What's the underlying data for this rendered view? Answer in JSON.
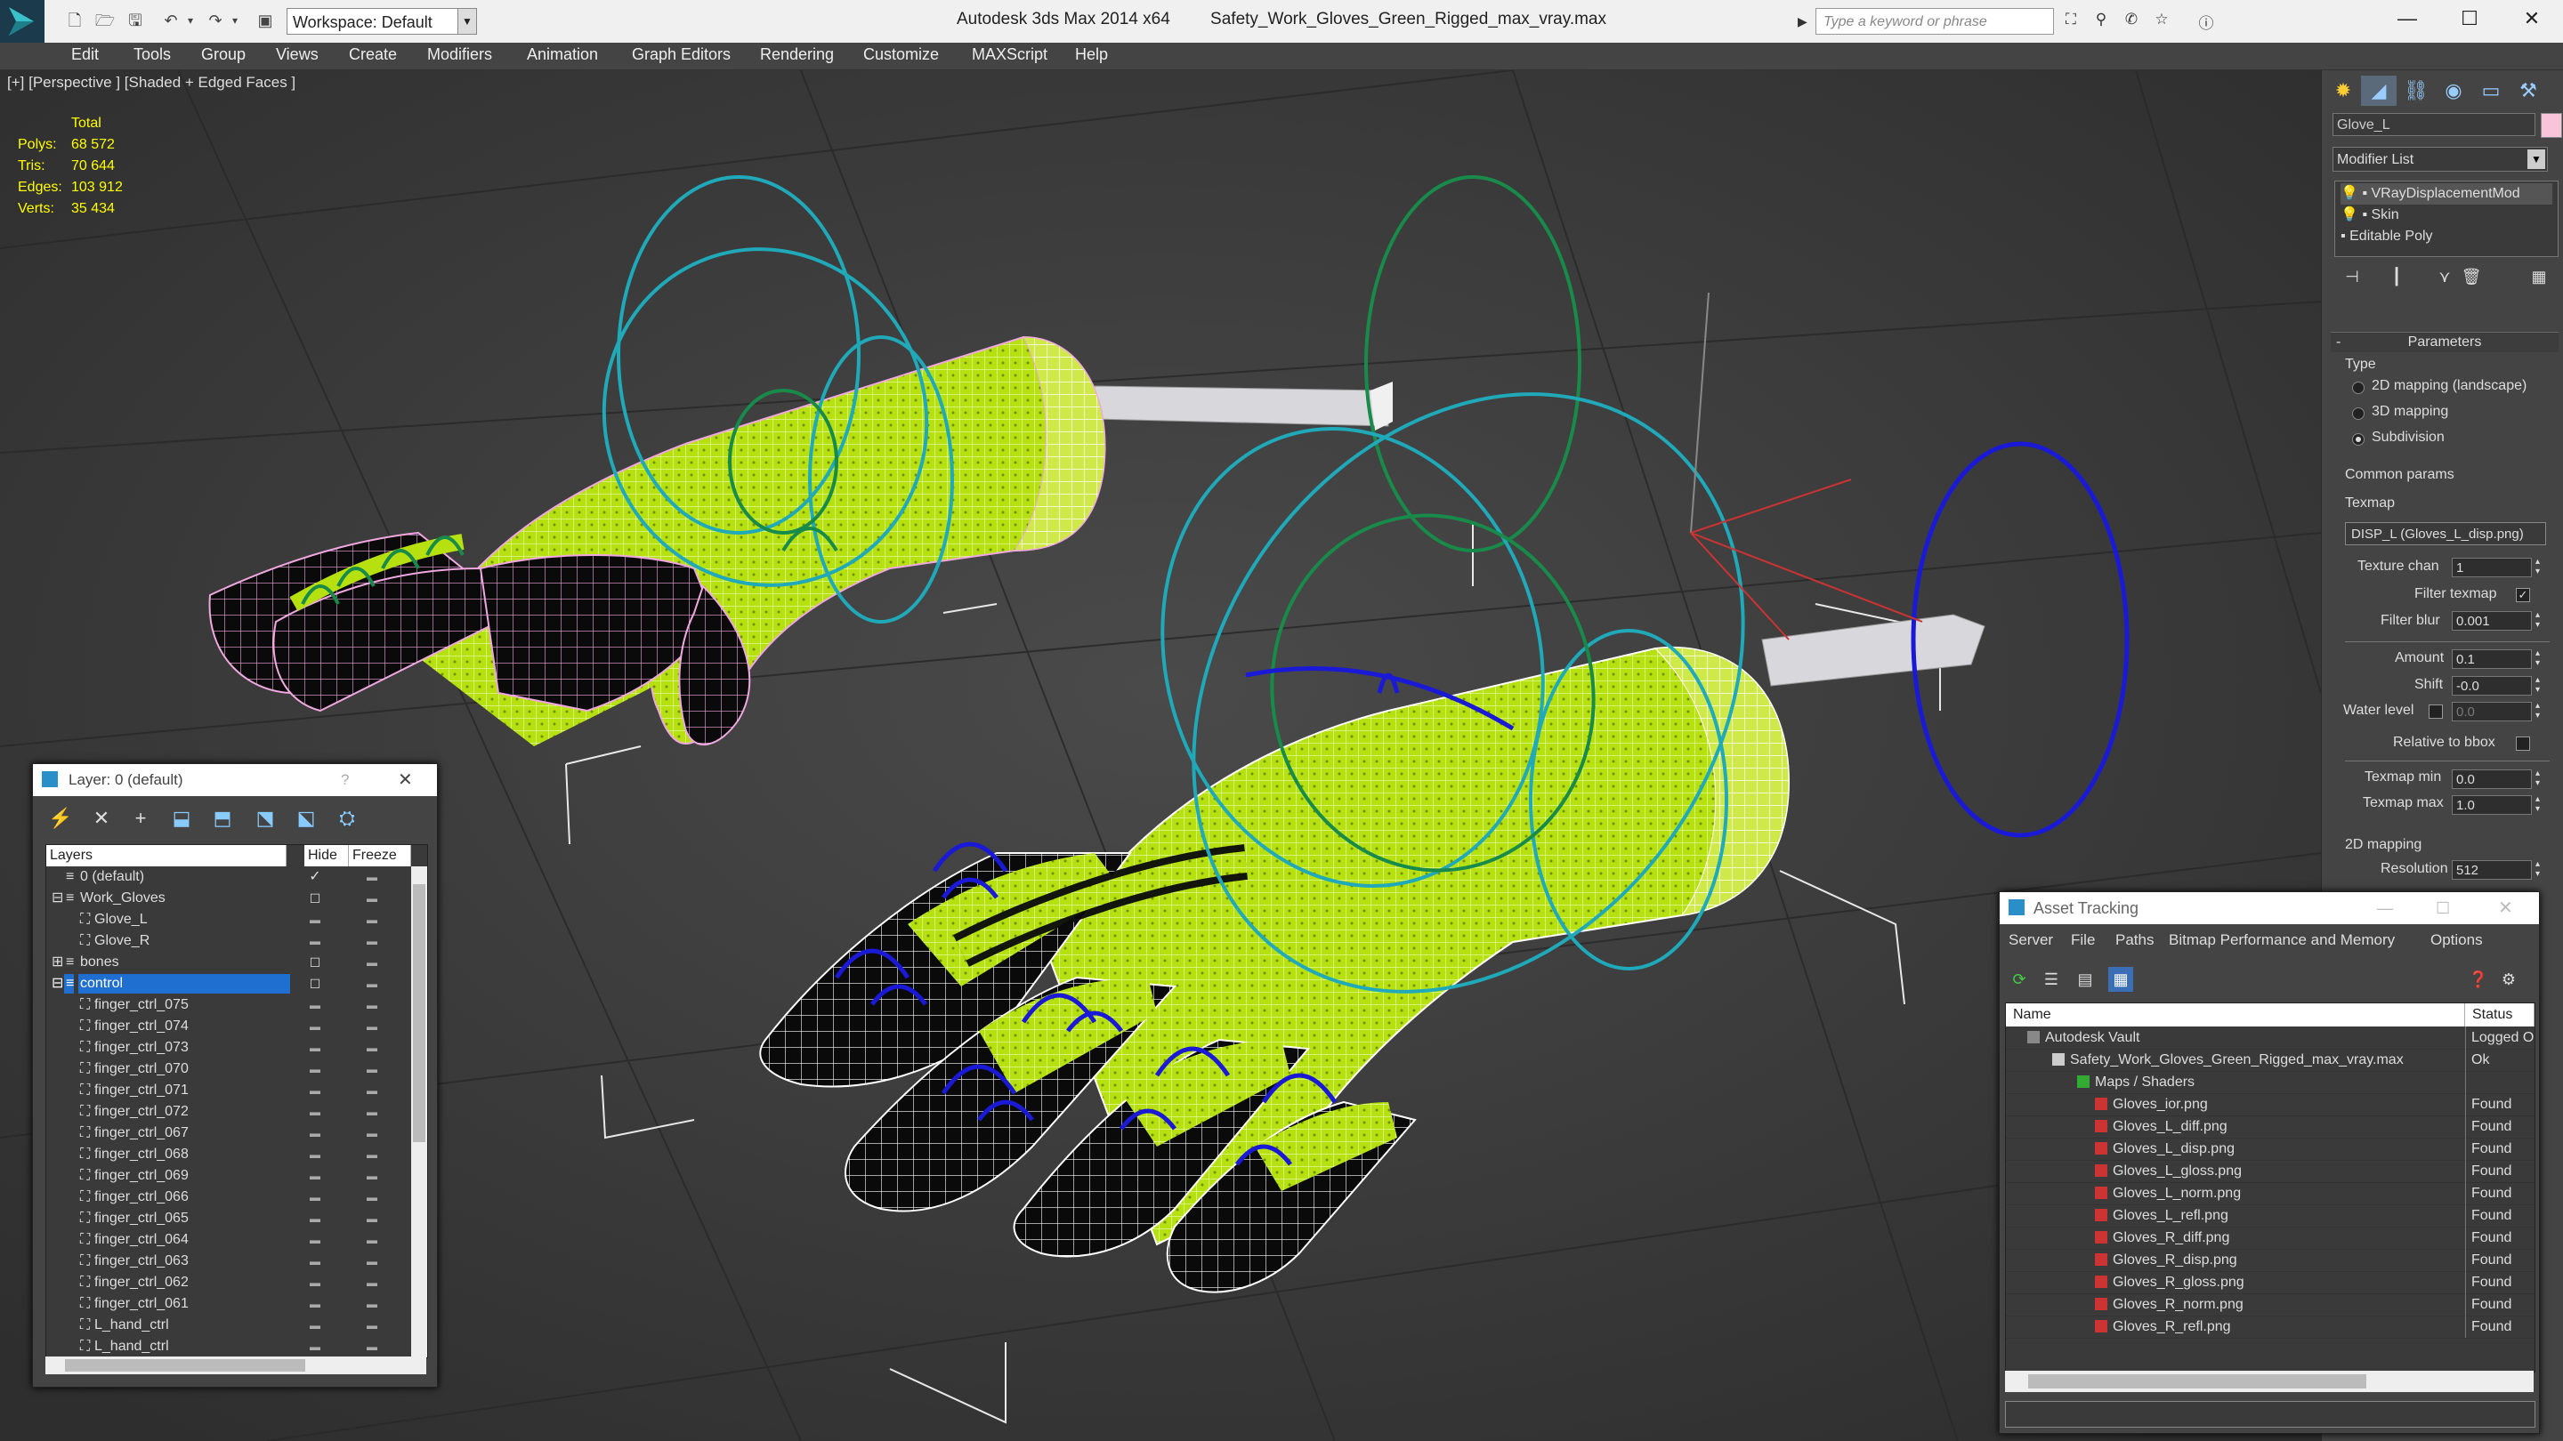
{
  "app": {
    "title": "Autodesk 3ds Max  2014 x64",
    "filename": "Safety_Work_Gloves_Green_Rigged_max_vray.max",
    "workspace": "Workspace: Default",
    "search_placeholder": "Type a keyword or phrase"
  },
  "menu": [
    "Edit",
    "Tools",
    "Group",
    "Views",
    "Create",
    "Modifiers",
    "Animation",
    "Graph Editors",
    "Rendering",
    "Customize",
    "MAXScript",
    "Help"
  ],
  "viewport": {
    "label": "[+] [Perspective ] [Shaded + Edged Faces ]",
    "stats": {
      "header": "Total",
      "polys_label": "Polys:",
      "polys": "68 572",
      "tris_label": "Tris:",
      "tris": "70 644",
      "edges_label": "Edges:",
      "edges": "103 912",
      "verts_label": "Verts:",
      "verts": "35 434"
    }
  },
  "command_panel": {
    "object_name": "Glove_L",
    "object_color": "#f7c4da",
    "modifier_list": "Modifier List",
    "stack": [
      "VRayDisplacementMod",
      "Skin",
      "Editable Poly"
    ],
    "parameters_title": "Parameters",
    "type_label": "Type",
    "type_options": [
      "2D mapping (landscape)",
      "3D mapping",
      "Subdivision"
    ],
    "common_params": "Common params",
    "texmap_label": "Texmap",
    "texmap_value": "DISP_L (Gloves_L_disp.png)",
    "texture_chan_label": "Texture chan",
    "texture_chan": "1",
    "filter_texmap_label": "Filter texmap",
    "filter_blur_label": "Filter blur",
    "filter_blur": "0.001",
    "amount_label": "Amount",
    "amount": "0.1",
    "shift_label": "Shift",
    "shift": "-0.0",
    "water_level_label": "Water level",
    "water_level": "0.0",
    "relative_bbox_label": "Relative to bbox",
    "texmap_min_label": "Texmap min",
    "texmap_min": "0.0",
    "texmap_max_label": "Texmap max",
    "texmap_max": "1.0",
    "mapping2d_label": "2D mapping",
    "resolution_label": "Resolution",
    "resolution": "512"
  },
  "layer_window": {
    "title": "Layer: 0 (default)",
    "help": "?",
    "columns": [
      "Layers",
      "Hide",
      "Freeze"
    ],
    "rows": [
      {
        "name": "0 (default)"
      },
      {
        "name": "Work_Gloves"
      },
      {
        "name": "Glove_L"
      },
      {
        "name": "Glove_R"
      },
      {
        "name": "bones"
      },
      {
        "name": "control"
      },
      {
        "name": "finger_ctrl_075"
      },
      {
        "name": "finger_ctrl_074"
      },
      {
        "name": "finger_ctrl_073"
      },
      {
        "name": "finger_ctrl_070"
      },
      {
        "name": "finger_ctrl_071"
      },
      {
        "name": "finger_ctrl_072"
      },
      {
        "name": "finger_ctrl_067"
      },
      {
        "name": "finger_ctrl_068"
      },
      {
        "name": "finger_ctrl_069"
      },
      {
        "name": "finger_ctrl_066"
      },
      {
        "name": "finger_ctrl_065"
      },
      {
        "name": "finger_ctrl_064"
      },
      {
        "name": "finger_ctrl_063"
      },
      {
        "name": "finger_ctrl_062"
      },
      {
        "name": "finger_ctrl_061"
      },
      {
        "name": "L_hand_ctrl"
      },
      {
        "name": "L_hand_ctrl"
      }
    ]
  },
  "asset_window": {
    "title": "Asset Tracking",
    "menu": [
      "Server",
      "File",
      "Paths",
      "Bitmap Performance and Memory",
      "Options"
    ],
    "columns": [
      "Name",
      "Status"
    ],
    "rows": [
      {
        "name": "Autodesk Vault",
        "status": "Logged Out"
      },
      {
        "name": "Safety_Work_Gloves_Green_Rigged_max_vray.max",
        "status": "Ok"
      },
      {
        "name": "Maps / Shaders",
        "status": ""
      },
      {
        "name": "Gloves_ior.png",
        "status": "Found"
      },
      {
        "name": "Gloves_L_diff.png",
        "status": "Found"
      },
      {
        "name": "Gloves_L_disp.png",
        "status": "Found"
      },
      {
        "name": "Gloves_L_gloss.png",
        "status": "Found"
      },
      {
        "name": "Gloves_L_norm.png",
        "status": "Found"
      },
      {
        "name": "Gloves_L_refl.png",
        "status": "Found"
      },
      {
        "name": "Gloves_R_diff.png",
        "status": "Found"
      },
      {
        "name": "Gloves_R_disp.png",
        "status": "Found"
      },
      {
        "name": "Gloves_R_gloss.png",
        "status": "Found"
      },
      {
        "name": "Gloves_R_norm.png",
        "status": "Found"
      },
      {
        "name": "Gloves_R_refl.png",
        "status": "Found"
      }
    ]
  },
  "colors": {
    "glove_green": "#b6e010",
    "cuff_white": "#f2f2f2",
    "coating_black": "#0a0a0a",
    "ctrl_cyan": "#1fa9b9",
    "ctrl_green": "#188a4a",
    "ctrl_blue": "#1a1ad6",
    "selection_blue": "#1f6fd0"
  }
}
